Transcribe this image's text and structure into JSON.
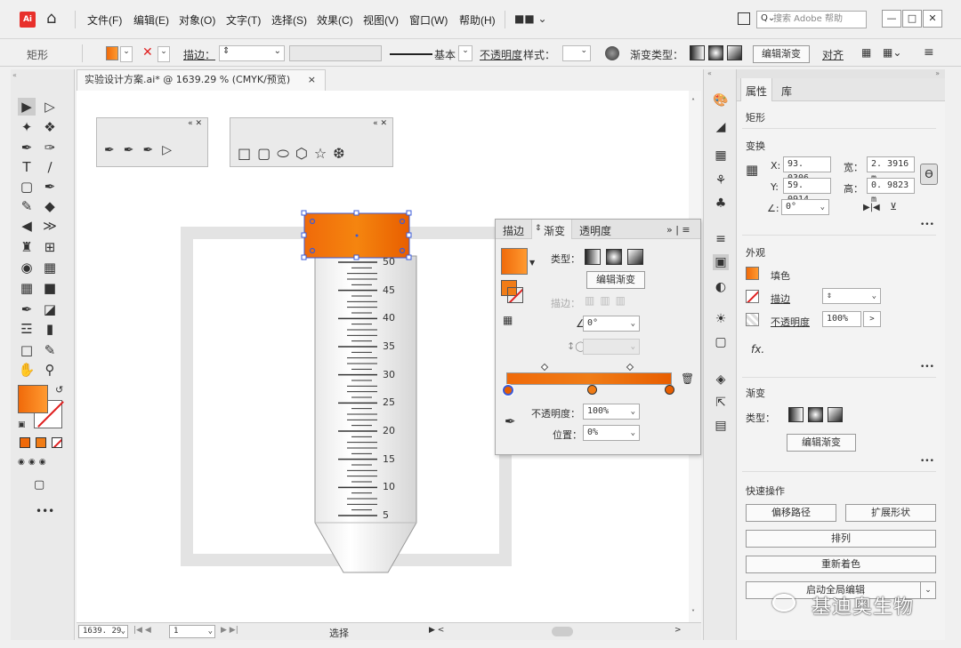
{
  "menubar": {
    "app_icon": "Ai",
    "home_icon": "home-icon",
    "items": [
      "文件(F)",
      "编辑(E)",
      "对象(O)",
      "文字(T)",
      "选择(S)",
      "效果(C)",
      "视图(V)",
      "窗口(W)",
      "帮助(H)"
    ],
    "search_placeholder": "搜索 Adobe 帮助",
    "win_min": "—",
    "win_max": "□",
    "win_close": "✕"
  },
  "controlbar": {
    "object_label": "矩形",
    "stroke_label": "描边：",
    "stroke_profile": "基本",
    "opacity_label": "不透明度",
    "style_label": "样式：",
    "gradient_type_label": "渐变类型：",
    "edit_gradient_btn": "编辑渐变",
    "align_label": "对齐"
  },
  "document": {
    "tab_title": "实验设计方案.ai* @ 1639.29 % (CMYK/预览)",
    "tab_close": "×",
    "tube_labels": [
      "50",
      "45",
      "40",
      "35",
      "30",
      "25",
      "20",
      "15",
      "10",
      "5"
    ]
  },
  "statusbar": {
    "zoom": "1639. 29",
    "artboard": "1",
    "mode": "选择"
  },
  "gradient_panel": {
    "tabs": [
      "描边",
      "渐变",
      "透明度"
    ],
    "type_label": "类型：",
    "edit_btn": "编辑渐变",
    "stroke_label": "描边：",
    "angle_value": "0°",
    "opacity_label": "不透明度：",
    "opacity_value": "100%",
    "position_label": "位置：",
    "position_value": "0%"
  },
  "properties": {
    "tabs": [
      "属性",
      "库"
    ],
    "object_type": "矩形",
    "transform_title": "变换",
    "x_label": "X:",
    "x_value": "93. 0306",
    "y_label": "Y:",
    "y_value": "59. 0914",
    "w_label": "宽：",
    "w_value": "2. 3916 m",
    "h_label": "高：",
    "h_value": "0. 9823 m",
    "rotate_value": "0°",
    "appearance_title": "外观",
    "fill_label": "填色",
    "stroke_label": "描边",
    "opacity_label": "不透明度",
    "opacity_value": "100%",
    "fx_label": "fx.",
    "gradient_title": "渐变",
    "gradient_type_label": "类型：",
    "edit_gradient_btn": "编辑渐变",
    "quick_actions_title": "快速操作",
    "offset_path_btn": "偏移路径",
    "expand_shape_btn": "扩展形状",
    "arrange_btn": "排列",
    "recolor_btn": "重新着色",
    "global_edit_btn": "启动全局编辑",
    "more": "•••"
  },
  "watermark": "基迪奥生物",
  "colors": {
    "gradient_start": "#f06a0a",
    "gradient_end": "#e85e00",
    "accent": "#f07c16",
    "selection": "#3b5bd9"
  }
}
